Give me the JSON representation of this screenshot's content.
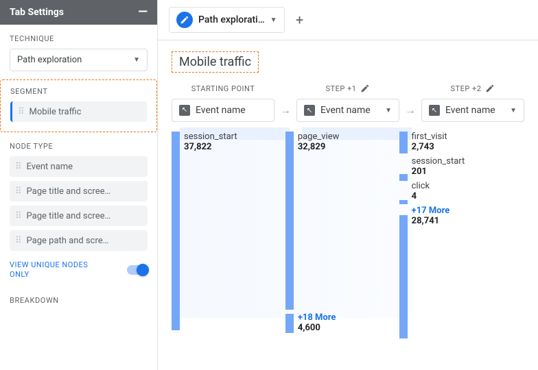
{
  "sidebar": {
    "header": "Tab Settings",
    "technique_label": "TECHNIQUE",
    "technique_value": "Path exploration",
    "segment_label": "SEGMENT",
    "segment_value": "Mobile traffic",
    "nodetype_label": "NODE TYPE",
    "nodetypes": [
      "Event name",
      "Page title and scree…",
      "Page title and scree…",
      "Page path and scre…"
    ],
    "view_unique_label": "VIEW UNIQUE NODES ONLY",
    "breakdown_label": "BREAKDOWN"
  },
  "header": {
    "tab_label": "Path explorati…",
    "title": "Mobile traffic"
  },
  "steps": {
    "start_label": "STARTING POINT",
    "step1_label": "STEP +1",
    "step2_label": "STEP +2",
    "node_label": "Event name"
  },
  "sankey": {
    "col0": [
      {
        "name": "session_start",
        "value": "37,822"
      }
    ],
    "col1": [
      {
        "name": "page_view",
        "value": "32,829"
      },
      {
        "name": "+18 More",
        "value": "4,600",
        "more": true
      }
    ],
    "col2": [
      {
        "name": "first_visit",
        "value": "2,743"
      },
      {
        "name": "session_start",
        "value": "201"
      },
      {
        "name": "click",
        "value": "4"
      },
      {
        "name": "+17 More",
        "value": "28,741",
        "more": true
      }
    ]
  }
}
